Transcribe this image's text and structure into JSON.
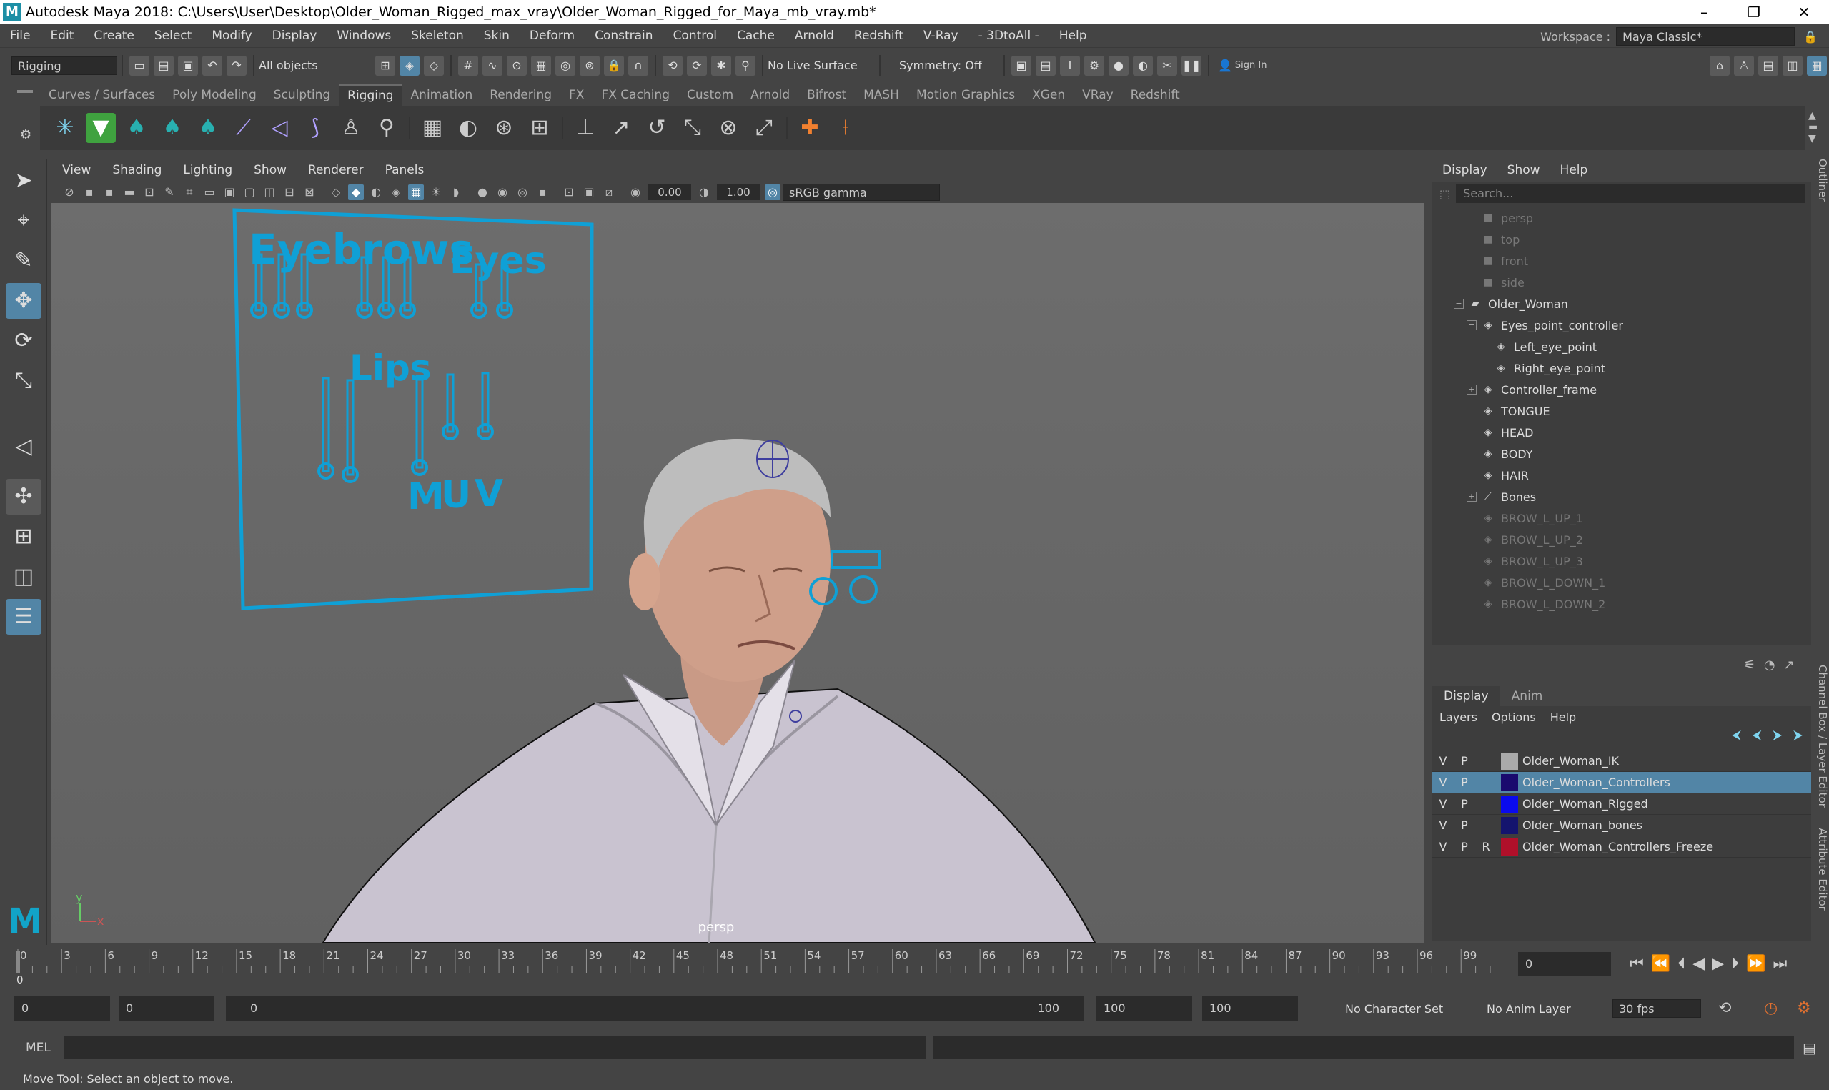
{
  "window": {
    "title": "Autodesk Maya 2018: C:\\Users\\User\\Desktop\\Older_Woman_Rigged_max_vray\\Older_Woman_Rigged_for_Maya_mb_vray.mb*"
  },
  "menubar": [
    "File",
    "Edit",
    "Create",
    "Select",
    "Modify",
    "Display",
    "Windows",
    "Skeleton",
    "Skin",
    "Deform",
    "Constrain",
    "Control",
    "Cache",
    "Arnold",
    "Redshift",
    "V-Ray",
    "- 3DtoAll -",
    "Help"
  ],
  "workspace": {
    "label": "Workspace :",
    "value": "Maya Classic*"
  },
  "statusline": {
    "mode": "Rigging",
    "selection_mask": "All objects",
    "live_surface": "No Live Surface",
    "symmetry": "Symmetry: Off",
    "sign_in": "Sign In"
  },
  "shelf_tabs": [
    "Curves / Surfaces",
    "Poly Modeling",
    "Sculpting",
    "Rigging",
    "Animation",
    "Rendering",
    "FX",
    "FX Caching",
    "Custom",
    "Arnold",
    "Bifrost",
    "MASH",
    "Motion Graphics",
    "XGen",
    "VRay",
    "Redshift"
  ],
  "panel_menu": [
    "View",
    "Shading",
    "Lighting",
    "Show",
    "Renderer",
    "Panels"
  ],
  "panel_toolbar": {
    "exposure": "0.00",
    "gamma": "1.00",
    "color_space": "sRGB gamma"
  },
  "viewport": {
    "camera": "persp",
    "board_labels": {
      "eyebrows": "Eyebrows",
      "eyes": "Eyes",
      "lips": "Lips",
      "m": "M",
      "u": "U",
      "v": "V"
    },
    "axis_x": "x",
    "axis_y": "y"
  },
  "outliner": {
    "menu": [
      "Display",
      "Show",
      "Help"
    ],
    "search_placeholder": "Search...",
    "items": [
      {
        "label": "persp",
        "icon": "camera-icon",
        "dim": true
      },
      {
        "label": "top",
        "icon": "camera-icon",
        "dim": true
      },
      {
        "label": "front",
        "icon": "camera-icon",
        "dim": true
      },
      {
        "label": "side",
        "icon": "camera-icon",
        "dim": true
      },
      {
        "label": "Older_Woman",
        "icon": "group-icon",
        "dim": false
      },
      {
        "label": "Eyes_point_controller",
        "icon": "transform-icon",
        "dim": false
      },
      {
        "label": "Left_eye_point",
        "icon": "transform-icon",
        "dim": false
      },
      {
        "label": "Right_eye_point",
        "icon": "transform-icon",
        "dim": false
      },
      {
        "label": "Controller_frame",
        "icon": "transform-icon",
        "dim": false
      },
      {
        "label": "TONGUE",
        "icon": "transform-icon",
        "dim": false
      },
      {
        "label": "HEAD",
        "icon": "transform-icon",
        "dim": false
      },
      {
        "label": "BODY",
        "icon": "transform-icon",
        "dim": false
      },
      {
        "label": "HAIR",
        "icon": "transform-icon",
        "dim": false
      },
      {
        "label": "Bones",
        "icon": "joint-icon",
        "dim": false
      },
      {
        "label": "BROW_L_UP_1",
        "icon": "transform-icon",
        "dim": true
      },
      {
        "label": "BROW_L_UP_2",
        "icon": "transform-icon",
        "dim": true
      },
      {
        "label": "BROW_L_UP_3",
        "icon": "transform-icon",
        "dim": true
      },
      {
        "label": "BROW_L_DOWN_1",
        "icon": "transform-icon",
        "dim": true
      },
      {
        "label": "BROW_L_DOWN_2",
        "icon": "transform-icon",
        "dim": true
      }
    ]
  },
  "layers": {
    "tabs": [
      "Display",
      "Anim"
    ],
    "menu": [
      "Layers",
      "Options",
      "Help"
    ],
    "rows": [
      {
        "v": "V",
        "p": "P",
        "r": "",
        "name": "Older_Woman_IK",
        "color": "#aaaaaa",
        "selected": false
      },
      {
        "v": "V",
        "p": "P",
        "r": "",
        "name": "Older_Woman_Controllers",
        "color": "#1a0a6e",
        "selected": true
      },
      {
        "v": "V",
        "p": "P",
        "r": "",
        "name": "Older_Woman_Rigged",
        "color": "#0a0aee",
        "selected": false
      },
      {
        "v": "V",
        "p": "P",
        "r": "",
        "name": "Older_Woman_bones",
        "color": "#14146e",
        "selected": false
      },
      {
        "v": "V",
        "p": "P",
        "r": "R",
        "name": "Older_Woman_Controllers_Freeze",
        "color": "#b0102a",
        "selected": false
      }
    ]
  },
  "timeline": {
    "ticks": [
      "0",
      "3",
      "6",
      "9",
      "12",
      "15",
      "18",
      "21",
      "24",
      "27",
      "30",
      "33",
      "36",
      "39",
      "42",
      "45",
      "48",
      "51",
      "54",
      "57",
      "60",
      "63",
      "66",
      "69",
      "72",
      "75",
      "78",
      "81",
      "84",
      "87",
      "90",
      "93",
      "96",
      "99"
    ],
    "current_frame": "0",
    "current_marker": "0"
  },
  "range": {
    "start": "0",
    "inner_start": "0",
    "slider_start": "0",
    "slider_end": "100",
    "end": "100",
    "outer_end": "100",
    "character_set": "No Character Set",
    "anim_layer": "No Anim Layer",
    "fps": "30 fps"
  },
  "cmdline": {
    "label": "MEL"
  },
  "helpline": {
    "text": "Move Tool: Select an object to move."
  }
}
